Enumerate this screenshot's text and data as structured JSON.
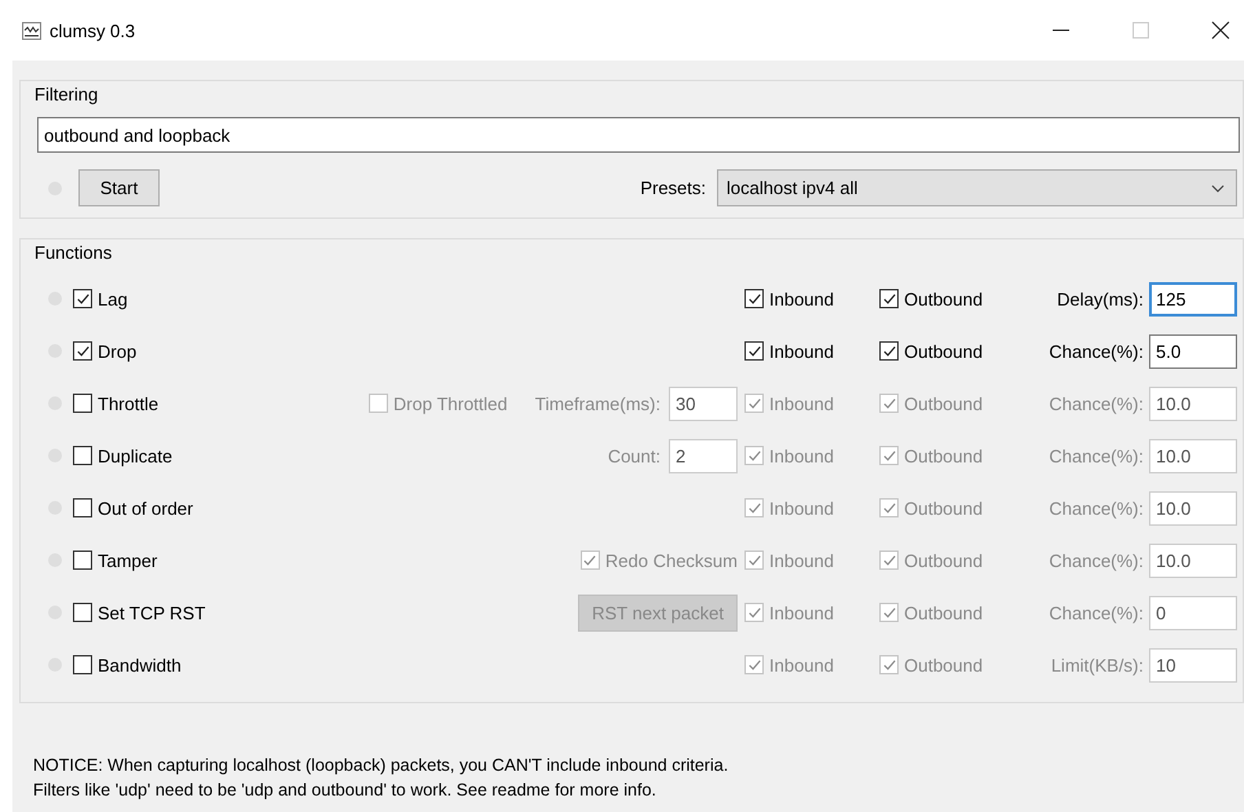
{
  "window": {
    "title": "clumsy 0.3"
  },
  "filtering": {
    "title": "Filtering",
    "filter": {
      "value": "outbound and loopback"
    },
    "start_button": "Start",
    "presets": {
      "label": "Presets:",
      "value": "localhost ipv4 all"
    }
  },
  "functions": {
    "title": "Functions",
    "items": [
      {
        "name": "Lag",
        "enabled": true,
        "inbound": {
          "label": "Inbound",
          "checked": true
        },
        "outbound": {
          "label": "Outbound",
          "checked": true
        },
        "param": {
          "label": "Delay(ms):",
          "value": "125",
          "focused": true
        }
      },
      {
        "name": "Drop",
        "enabled": true,
        "inbound": {
          "label": "Inbound",
          "checked": true
        },
        "outbound": {
          "label": "Outbound",
          "checked": true
        },
        "param": {
          "label": "Chance(%):",
          "value": "5.0",
          "focused": false
        }
      },
      {
        "name": "Throttle",
        "enabled": false,
        "extras": [
          {
            "kind": "checkbox",
            "label": "Drop Throttled",
            "checked": false
          },
          {
            "kind": "field",
            "label": "Timeframe(ms):",
            "value": "30"
          }
        ],
        "inbound": {
          "label": "Inbound",
          "checked": true
        },
        "outbound": {
          "label": "Outbound",
          "checked": true
        },
        "param": {
          "label": "Chance(%):",
          "value": "10.0",
          "focused": false
        }
      },
      {
        "name": "Duplicate",
        "enabled": false,
        "extras": [
          {
            "kind": "field",
            "label": "Count:",
            "value": "2"
          }
        ],
        "inbound": {
          "label": "Inbound",
          "checked": true
        },
        "outbound": {
          "label": "Outbound",
          "checked": true
        },
        "param": {
          "label": "Chance(%):",
          "value": "10.0",
          "focused": false
        }
      },
      {
        "name": "Out of order",
        "enabled": false,
        "inbound": {
          "label": "Inbound",
          "checked": true
        },
        "outbound": {
          "label": "Outbound",
          "checked": true
        },
        "param": {
          "label": "Chance(%):",
          "value": "10.0",
          "focused": false
        }
      },
      {
        "name": "Tamper",
        "enabled": false,
        "extras": [
          {
            "kind": "checkbox",
            "label": "Redo Checksum",
            "checked": true
          }
        ],
        "inbound": {
          "label": "Inbound",
          "checked": true
        },
        "outbound": {
          "label": "Outbound",
          "checked": true
        },
        "param": {
          "label": "Chance(%):",
          "value": "10.0",
          "focused": false
        }
      },
      {
        "name": "Set TCP RST",
        "enabled": false,
        "extras": [
          {
            "kind": "button",
            "label": "RST next packet"
          }
        ],
        "inbound": {
          "label": "Inbound",
          "checked": true
        },
        "outbound": {
          "label": "Outbound",
          "checked": true
        },
        "param": {
          "label": "Chance(%):",
          "value": "0",
          "focused": false
        }
      },
      {
        "name": "Bandwidth",
        "enabled": false,
        "inbound": {
          "label": "Inbound",
          "checked": true
        },
        "outbound": {
          "label": "Outbound",
          "checked": true
        },
        "param": {
          "label": "Limit(KB/s):",
          "value": "10",
          "focused": false
        }
      }
    ]
  },
  "notice": [
    "NOTICE: When capturing localhost (loopback) packets, you CAN'T include inbound criteria.",
    "Filters like 'udp' need to be 'udp and outbound' to work. See readme for more info."
  ]
}
